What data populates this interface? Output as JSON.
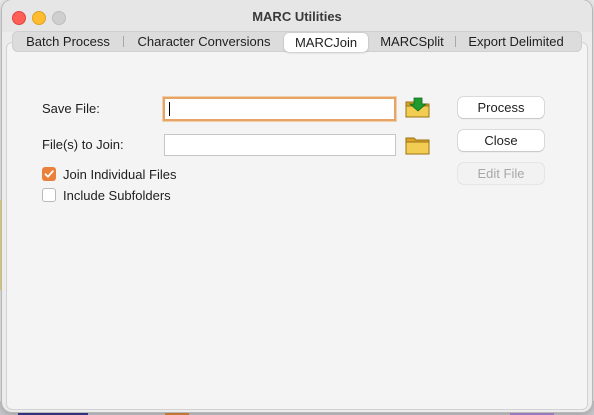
{
  "window": {
    "title": "MARC Utilities"
  },
  "tabs": [
    {
      "label": "Batch Process",
      "active": false
    },
    {
      "label": "Character Conversions",
      "active": false
    },
    {
      "label": "MARCJoin",
      "active": true
    },
    {
      "label": "MARCSplit",
      "active": false
    },
    {
      "label": "Export Delimited",
      "active": false
    }
  ],
  "form": {
    "save_file_label": "Save File:",
    "save_file_value": "",
    "files_to_join_label": "File(s) to Join:",
    "files_to_join_value": "",
    "join_individual_label": "Join Individual Files",
    "join_individual_checked": true,
    "include_subfolders_label": "Include Subfolders",
    "include_subfolders_checked": false
  },
  "buttons": {
    "process": "Process",
    "close": "Close",
    "edit_file": "Edit File"
  },
  "icons": {
    "save_browse": "folder-download-icon",
    "join_browse": "folder-icon"
  },
  "colors": {
    "accent": "#e9813d",
    "focus_ring": "#e7a468"
  }
}
